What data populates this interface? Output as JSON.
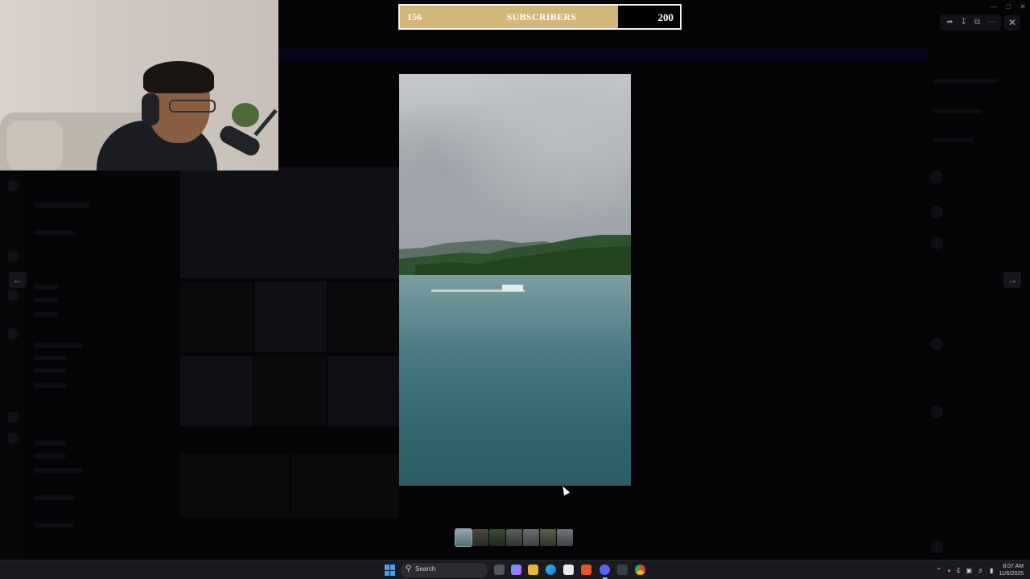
{
  "subscriber_bar": {
    "current": "156",
    "label": "SUBSCRIBERS",
    "goal": "200",
    "progress_fraction": 0.78,
    "fill_color": "#d3b67a"
  },
  "viewer": {
    "toolbar_icons": [
      "forward-icon",
      "download-icon",
      "open-external-icon",
      "more-icon"
    ],
    "close_icon": "close-icon",
    "prev_icon": "arrow-left-icon",
    "next_icon": "arrow-right-icon",
    "thumbnail_count": 7,
    "active_thumbnail": 0
  },
  "taskbar": {
    "search_placeholder": "Search",
    "time": "8:07 AM",
    "date": "11/6/2025",
    "pinned_apps": [
      "task-view",
      "copilot",
      "file-explorer",
      "edge",
      "microsoft-store",
      "brave",
      "discord",
      "terminal",
      "chrome"
    ]
  },
  "colors": {
    "accent": "#3fa2f3",
    "backdrop": "#030304"
  }
}
